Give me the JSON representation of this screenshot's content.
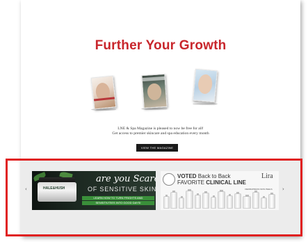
{
  "hero": {
    "title": "Further Your Growth"
  },
  "magazine_covers": [
    {
      "name": "cover-1"
    },
    {
      "name": "cover-2"
    },
    {
      "name": "cover-3"
    }
  ],
  "blurb": {
    "line1": "LNE & Spa Magazine is pleased to now be free for all!",
    "line2": "Get access to premier skincare and spa education every month"
  },
  "cta": {
    "label": "VIEW THE MAGAZINE"
  },
  "carousel": {
    "prev_icon": "chevron-left-icon",
    "next_icon": "chevron-right-icon",
    "prev_glyph": "‹",
    "next_glyph": "›",
    "ads": [
      {
        "brand": "HALE&HUSH",
        "line1": "are you Scared",
        "line2": "OF SENSITIVE SKIN?",
        "line3": "LEARN HOW TO TURN FRIGHTS AND",
        "line4": "SENSITIVITIES INTO GOOD DAYS!"
      },
      {
        "voted": "VOTED",
        "voted_rest": "Back to Back",
        "favorite": "FAVORITE",
        "clinical": "CLINICAL LINE",
        "brand": "Lira",
        "small": "DERMAPRESS SKIN PEELS"
      }
    ]
  },
  "colors": {
    "headline": "#c8262c",
    "button_bg": "#1a1a1a",
    "carousel_bg": "#ececec",
    "highlight_border": "#e02020"
  }
}
